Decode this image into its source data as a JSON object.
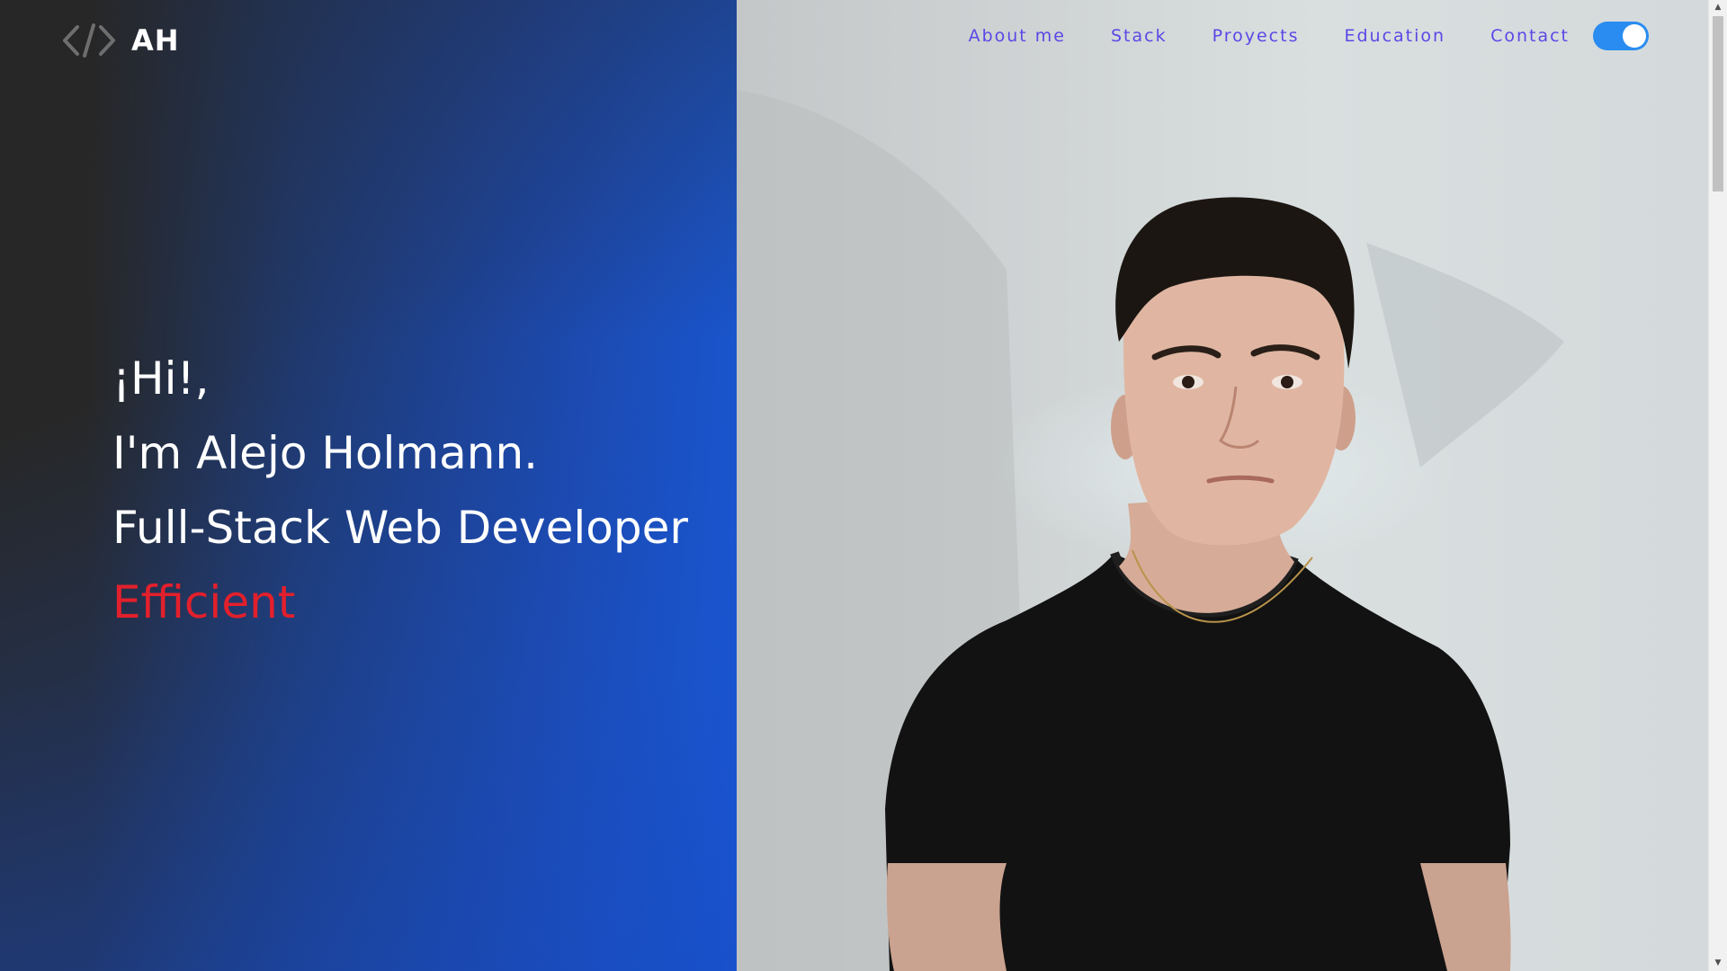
{
  "logo": {
    "icon": "code-brackets-icon",
    "text": "AH"
  },
  "hero": {
    "greeting": "¡Hi!,",
    "intro": "I'm Alejo Holmann.",
    "role": "Full-Stack Web Developer",
    "accent_word": "Efficient"
  },
  "nav": {
    "items": [
      {
        "label": "About me"
      },
      {
        "label": "Stack"
      },
      {
        "label": "Proyects"
      },
      {
        "label": "Education"
      },
      {
        "label": "Contact"
      }
    ],
    "theme_toggle": {
      "state": "on",
      "icon": "theme-toggle-icon"
    }
  },
  "photo": {
    "subject": "portrait-photo"
  },
  "colors": {
    "nav_link": "#5b47e6",
    "accent": "#e2202c",
    "toggle": "#2a8cf0",
    "left_gradient_start": "#272727",
    "left_gradient_end": "#1a55cc"
  }
}
